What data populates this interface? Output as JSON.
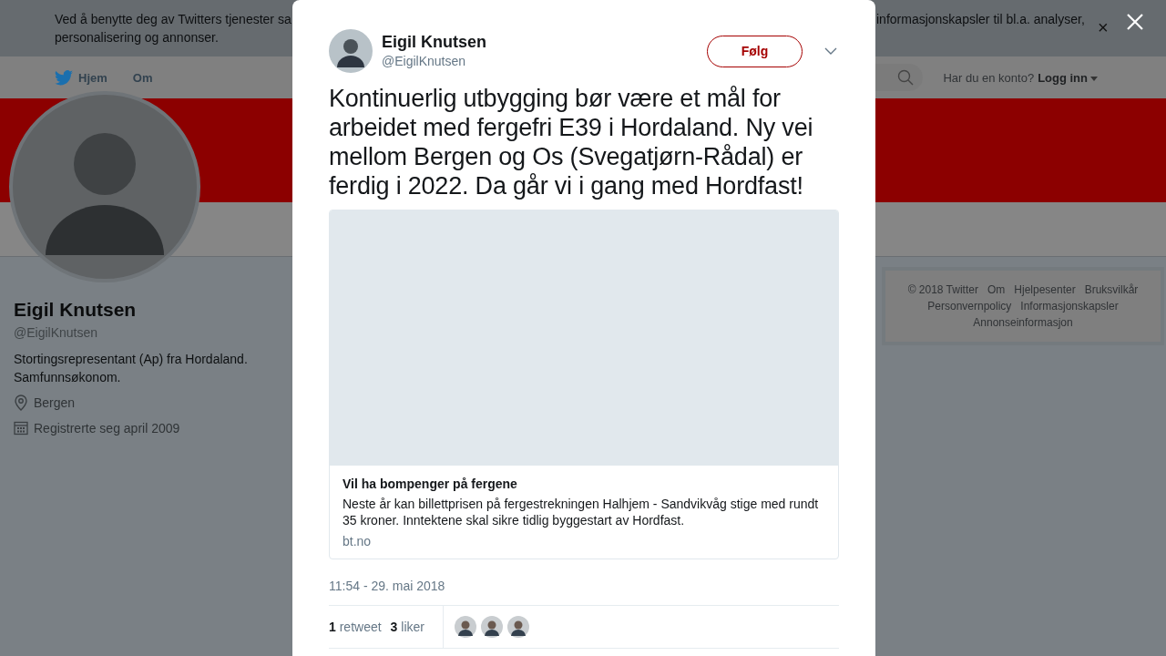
{
  "cookie_banner": {
    "line_1_start": "Ved å benytte deg av Twitters tjenester sa",
    "line_1_end": "informasjonskapsler til bl.a. analyser,",
    "line_2_start": "personalisering og annonser.",
    "close_label": "×"
  },
  "nav": {
    "items": [
      {
        "label": "Hjem",
        "kind": "home"
      },
      {
        "label": "Om",
        "kind": "plain"
      }
    ],
    "login_prompt": "Har du en konto?",
    "login_link": "Logg inn"
  },
  "profile": {
    "name": "Eigil Knutsen",
    "handle": "@EigilKnutsen",
    "bio": "Stortingsrepresentant (Ap) fra Hordaland. Samfunnsøkonom.",
    "location": "Bergen",
    "joined": "Registrerte seg april 2009"
  },
  "footer": {
    "links": [
      "© 2018 Twitter",
      "Om",
      "Hjelpesenter",
      "Bruksvilkår",
      "Personvernpolicy",
      "Informasjonskapsler",
      "Annonseinformasjon"
    ]
  },
  "tweet": {
    "author": "Eigil Knutsen",
    "handle": "@EigilKnutsen",
    "follow_label": "Følg",
    "text": "Kontinuerlig utbygging bør være et mål for arbeidet med fergefri E39 i Hordaland. Ny vei mellom Bergen og Os (Svegatjørn-Rådal) er ferdig i 2022. Da går vi i gang med Hordfast!",
    "card": {
      "title": "Vil ha bompenger på fergene",
      "description": "Neste år kan billettprisen på fergestrekningen Halhjem - Sandvikvåg stige med rundt 35 kroner. Inntektene skal sikre tidlig byggestart av Hordfast.",
      "domain": "bt.no"
    },
    "timestamp": "11:54 - 29. mai 2018",
    "stats": [
      {
        "count": "1",
        "label": "retweet"
      },
      {
        "count": "3",
        "label": "liker"
      }
    ],
    "liker_avatars": [
      {
        "kind": "avatar"
      },
      {
        "kind": "avatar"
      },
      {
        "kind": "avatar"
      }
    ]
  }
}
